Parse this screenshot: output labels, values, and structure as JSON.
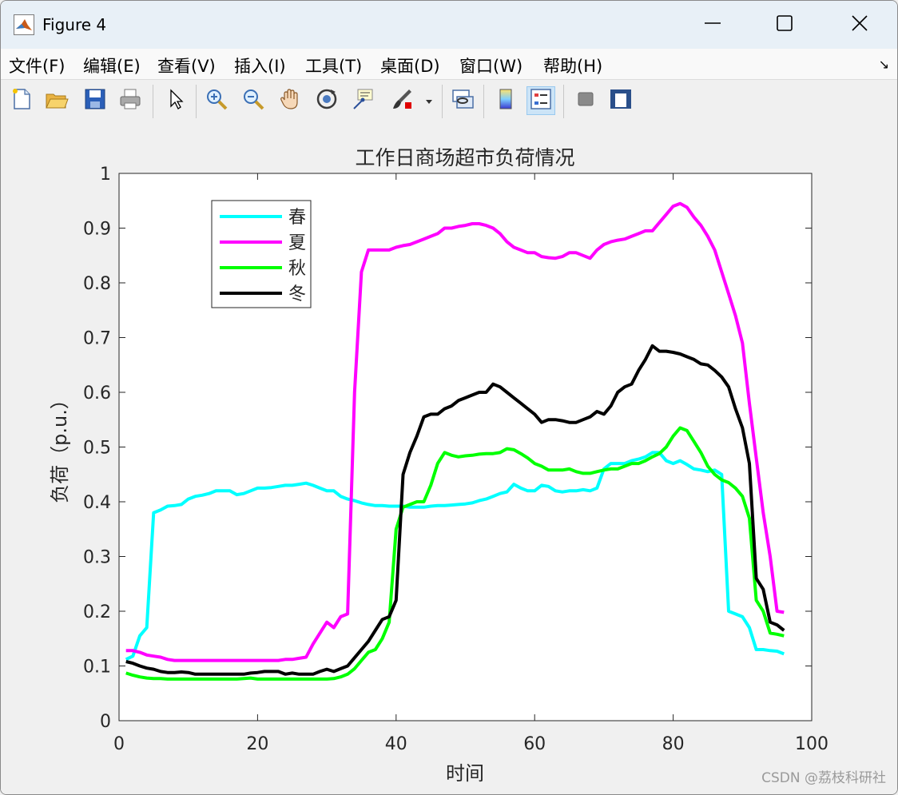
{
  "window": {
    "title": "Figure 4",
    "icon": "matlab-icon",
    "controls": [
      "minimize-icon",
      "maximize-icon",
      "close-icon"
    ]
  },
  "menu": {
    "items": [
      "文件(F)",
      "编辑(E)",
      "查看(V)",
      "插入(I)",
      "工具(T)",
      "桌面(D)",
      "窗口(W)",
      "帮助(H)"
    ],
    "overflow_icon": "dock-arrow-icon"
  },
  "toolbar": {
    "buttons": [
      {
        "icon": "new-figure-icon"
      },
      {
        "icon": "open-file-icon"
      },
      {
        "icon": "save-icon"
      },
      {
        "icon": "print-icon"
      },
      {
        "icon": "edit-plot-arrow-icon"
      },
      {
        "icon": "zoom-in-icon"
      },
      {
        "icon": "zoom-out-icon"
      },
      {
        "icon": "pan-hand-icon"
      },
      {
        "icon": "rotate-3d-icon"
      },
      {
        "icon": "data-cursor-icon"
      },
      {
        "icon": "brush-icon"
      },
      {
        "icon": "link-plot-icon"
      },
      {
        "icon": "colorbar-icon"
      },
      {
        "icon": "legend-icon",
        "active": true
      },
      {
        "icon": "hide-plot-tools-icon"
      },
      {
        "icon": "show-plot-tools-icon"
      }
    ]
  },
  "watermark": "CSDN @荔枝科研社",
  "chart_data": {
    "type": "line",
    "title": "工作日商场超市负荷情况",
    "xlabel": "时间",
    "ylabel": "负荷（p.u.）",
    "xlim": [
      0,
      100
    ],
    "ylim": [
      0,
      1
    ],
    "xticks": [
      0,
      20,
      40,
      60,
      80,
      100
    ],
    "yticks": [
      0,
      0.1,
      0.2,
      0.3,
      0.4,
      0.5,
      0.6,
      0.7,
      0.8,
      0.9,
      1
    ],
    "ytick_labels": [
      "0",
      "0.1",
      "0.2",
      "0.3",
      "0.4",
      "0.5",
      "0.6",
      "0.7",
      "0.8",
      "0.9",
      "1"
    ],
    "grid": false,
    "legend_position": "top-left",
    "x": [
      1,
      2,
      3,
      4,
      5,
      6,
      7,
      8,
      9,
      10,
      11,
      12,
      13,
      14,
      15,
      16,
      17,
      18,
      19,
      20,
      21,
      22,
      23,
      24,
      25,
      26,
      27,
      28,
      29,
      30,
      31,
      32,
      33,
      34,
      35,
      36,
      37,
      38,
      39,
      40,
      41,
      42,
      43,
      44,
      45,
      46,
      47,
      48,
      49,
      50,
      51,
      52,
      53,
      54,
      55,
      56,
      57,
      58,
      59,
      60,
      61,
      62,
      63,
      64,
      65,
      66,
      67,
      68,
      69,
      70,
      71,
      72,
      73,
      74,
      75,
      76,
      77,
      78,
      79,
      80,
      81,
      82,
      83,
      84,
      85,
      86,
      87,
      88,
      89,
      90,
      91,
      92,
      93,
      94,
      95,
      96
    ],
    "series": [
      {
        "name": "春",
        "color": "#00ffff",
        "values": [
          0.112,
          0.118,
          0.155,
          0.17,
          0.38,
          0.385,
          0.392,
          0.393,
          0.395,
          0.405,
          0.41,
          0.412,
          0.415,
          0.42,
          0.42,
          0.42,
          0.413,
          0.415,
          0.42,
          0.425,
          0.425,
          0.426,
          0.428,
          0.43,
          0.43,
          0.432,
          0.434,
          0.43,
          0.425,
          0.42,
          0.42,
          0.41,
          0.405,
          0.402,
          0.398,
          0.395,
          0.393,
          0.393,
          0.392,
          0.392,
          0.392,
          0.39,
          0.39,
          0.39,
          0.392,
          0.393,
          0.393,
          0.394,
          0.395,
          0.396,
          0.398,
          0.402,
          0.405,
          0.41,
          0.415,
          0.418,
          0.432,
          0.425,
          0.42,
          0.42,
          0.43,
          0.428,
          0.42,
          0.418,
          0.42,
          0.42,
          0.422,
          0.42,
          0.425,
          0.46,
          0.47,
          0.47,
          0.47,
          0.475,
          0.478,
          0.482,
          0.49,
          0.49,
          0.475,
          0.47,
          0.475,
          0.468,
          0.46,
          0.458,
          0.455,
          0.458,
          0.45,
          0.2,
          0.195,
          0.19,
          0.17,
          0.13,
          0.13,
          0.128,
          0.127,
          0.122
        ]
      },
      {
        "name": "夏",
        "color": "#ff00ff",
        "values": [
          0.128,
          0.128,
          0.125,
          0.12,
          0.118,
          0.116,
          0.112,
          0.11,
          0.11,
          0.11,
          0.11,
          0.11,
          0.11,
          0.11,
          0.11,
          0.11,
          0.11,
          0.11,
          0.11,
          0.11,
          0.11,
          0.11,
          0.11,
          0.112,
          0.112,
          0.114,
          0.116,
          0.14,
          0.16,
          0.18,
          0.17,
          0.19,
          0.195,
          0.6,
          0.82,
          0.86,
          0.86,
          0.86,
          0.86,
          0.865,
          0.868,
          0.87,
          0.875,
          0.88,
          0.885,
          0.89,
          0.9,
          0.9,
          0.903,
          0.905,
          0.908,
          0.908,
          0.905,
          0.9,
          0.89,
          0.875,
          0.865,
          0.86,
          0.855,
          0.855,
          0.848,
          0.846,
          0.845,
          0.848,
          0.855,
          0.855,
          0.85,
          0.845,
          0.86,
          0.87,
          0.875,
          0.878,
          0.88,
          0.885,
          0.89,
          0.895,
          0.895,
          0.91,
          0.925,
          0.94,
          0.945,
          0.938,
          0.92,
          0.905,
          0.885,
          0.86,
          0.82,
          0.78,
          0.74,
          0.69,
          0.58,
          0.48,
          0.38,
          0.3,
          0.2,
          0.198
        ]
      },
      {
        "name": "秋",
        "color": "#00ff00",
        "values": [
          0.087,
          0.083,
          0.08,
          0.078,
          0.077,
          0.077,
          0.076,
          0.076,
          0.076,
          0.076,
          0.076,
          0.076,
          0.076,
          0.076,
          0.076,
          0.076,
          0.076,
          0.077,
          0.078,
          0.076,
          0.076,
          0.076,
          0.076,
          0.076,
          0.076,
          0.076,
          0.076,
          0.076,
          0.076,
          0.076,
          0.077,
          0.08,
          0.085,
          0.095,
          0.11,
          0.125,
          0.13,
          0.15,
          0.18,
          0.35,
          0.39,
          0.395,
          0.4,
          0.4,
          0.43,
          0.47,
          0.49,
          0.485,
          0.482,
          0.484,
          0.485,
          0.487,
          0.488,
          0.488,
          0.49,
          0.497,
          0.495,
          0.488,
          0.48,
          0.47,
          0.465,
          0.458,
          0.458,
          0.458,
          0.46,
          0.455,
          0.452,
          0.452,
          0.455,
          0.458,
          0.46,
          0.46,
          0.465,
          0.47,
          0.47,
          0.475,
          0.482,
          0.488,
          0.5,
          0.52,
          0.535,
          0.53,
          0.51,
          0.49,
          0.465,
          0.45,
          0.44,
          0.435,
          0.425,
          0.41,
          0.37,
          0.22,
          0.2,
          0.16,
          0.158,
          0.155
        ]
      },
      {
        "name": "冬",
        "color": "#000000",
        "values": [
          0.108,
          0.105,
          0.1,
          0.096,
          0.094,
          0.09,
          0.088,
          0.088,
          0.089,
          0.088,
          0.085,
          0.085,
          0.085,
          0.085,
          0.085,
          0.085,
          0.085,
          0.085,
          0.087,
          0.088,
          0.09,
          0.09,
          0.09,
          0.085,
          0.087,
          0.085,
          0.085,
          0.085,
          0.09,
          0.094,
          0.09,
          0.095,
          0.1,
          0.115,
          0.13,
          0.145,
          0.165,
          0.185,
          0.19,
          0.22,
          0.45,
          0.49,
          0.52,
          0.555,
          0.56,
          0.56,
          0.57,
          0.575,
          0.585,
          0.59,
          0.595,
          0.6,
          0.6,
          0.615,
          0.61,
          0.6,
          0.59,
          0.58,
          0.57,
          0.56,
          0.545,
          0.55,
          0.55,
          0.548,
          0.545,
          0.545,
          0.55,
          0.555,
          0.565,
          0.56,
          0.575,
          0.6,
          0.61,
          0.615,
          0.64,
          0.66,
          0.685,
          0.675,
          0.675,
          0.673,
          0.67,
          0.665,
          0.66,
          0.652,
          0.65,
          0.64,
          0.628,
          0.61,
          0.57,
          0.535,
          0.47,
          0.26,
          0.24,
          0.18,
          0.175,
          0.165
        ]
      }
    ]
  }
}
